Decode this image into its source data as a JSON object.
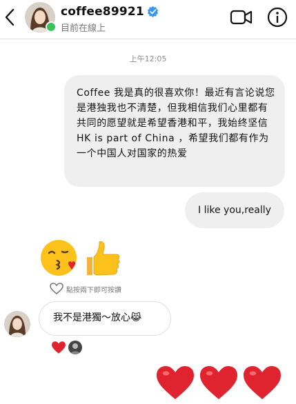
{
  "header": {
    "username": "coffee89921",
    "status": "目前在線上",
    "icons": [
      "back-chevron-icon",
      "avatar",
      "verified-badge-icon",
      "video-call-icon",
      "info-icon"
    ]
  },
  "thread": {
    "timestamp": "上午12:05",
    "messages": [
      {
        "from": "me",
        "text": "Coffee 我是真的很喜欢你！最近有言论说您是港独我也不清楚，但我相信我们心里都有共同的愿望就是希望香港和平，我始终坚信HK is part of China ，希望我们都有作为一个中国人对国家的热爱"
      },
      {
        "from": "me",
        "text": "I like you,really"
      },
      {
        "from": "them",
        "stickers": [
          "kiss-emoji",
          "thumbs-up-emoji"
        ],
        "hint": "點按兩下即可按讚"
      },
      {
        "from": "them",
        "text": "我不是港獨～放心😹",
        "reactions": [
          "heart",
          "avatar"
        ]
      },
      {
        "from": "me",
        "stickers": [
          "red-heart",
          "red-heart",
          "red-heart"
        ]
      }
    ]
  },
  "colors": {
    "bubble_gray": "#efefef",
    "verified_blue": "#3897f0",
    "online_green": "#3cc25a",
    "heart_red": "#e0242f"
  }
}
